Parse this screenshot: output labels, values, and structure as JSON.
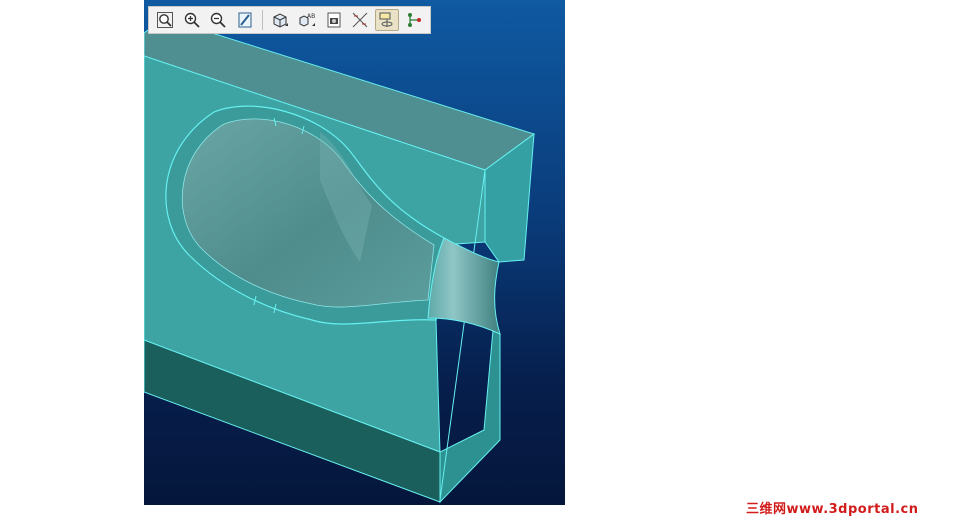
{
  "toolbar": {
    "buttons": [
      {
        "id": "refit",
        "icon": "magnifier-frame-icon"
      },
      {
        "id": "zoom-in",
        "icon": "zoom-in-icon"
      },
      {
        "id": "zoom-out",
        "icon": "zoom-out-icon"
      },
      {
        "id": "repaint",
        "icon": "repaint-icon"
      },
      {
        "id": "view-orient",
        "icon": "cube-orient-icon"
      },
      {
        "id": "saved-views",
        "icon": "saved-views-icon",
        "text": "AB"
      },
      {
        "id": "snapshot",
        "icon": "camera-icon"
      },
      {
        "id": "datum-display",
        "icon": "datum-axes-icon"
      },
      {
        "id": "display-style",
        "icon": "display-style-icon",
        "active": true
      },
      {
        "id": "model-tree",
        "icon": "model-tree-icon"
      }
    ]
  },
  "viewport": {
    "background_top": "#0f5aa2",
    "background_bottom": "#05163b",
    "model_color": "#3aa0a0",
    "edge_color": "#66f0f0"
  },
  "watermark": {
    "text": "三维网www.3dportal.cn",
    "color": "#d11c1c"
  }
}
